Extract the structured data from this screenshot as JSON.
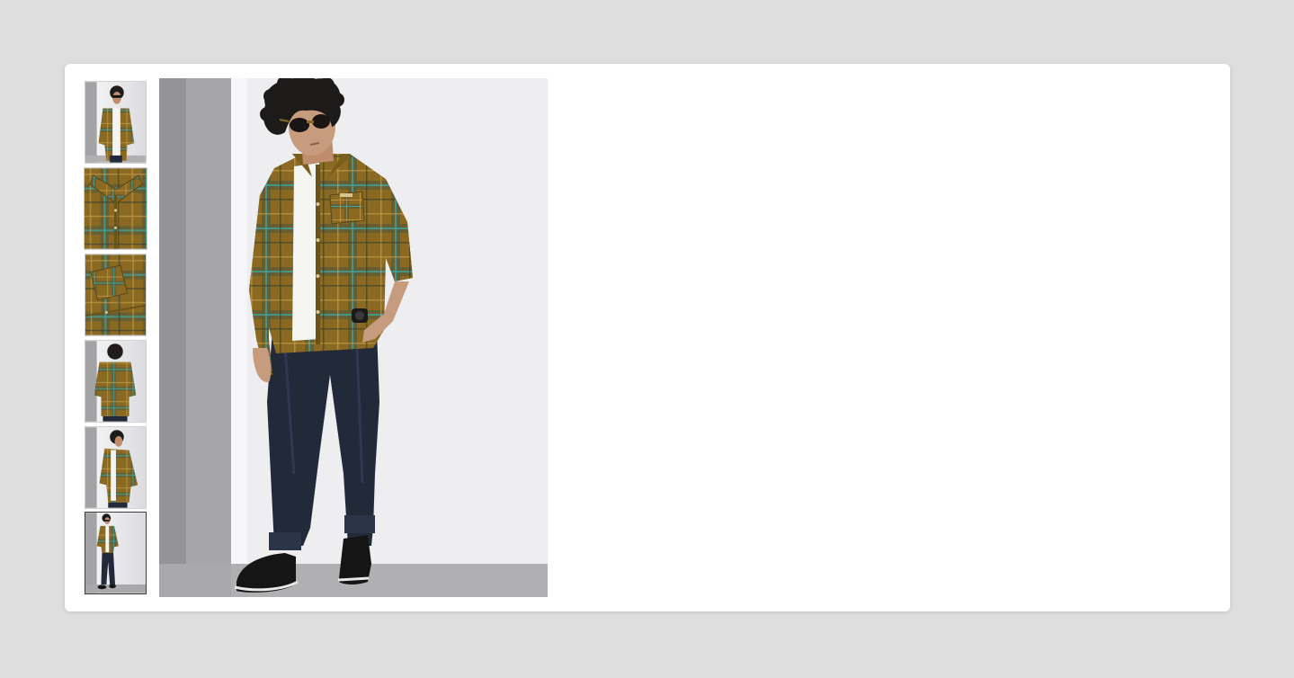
{
  "gallery": {
    "thumbnails": [
      {
        "view": "front-model-sunglasses",
        "selected": false
      },
      {
        "view": "collar-closeup",
        "selected": false
      },
      {
        "view": "fabric-pocket-closeup",
        "selected": false
      },
      {
        "view": "back-model",
        "selected": false
      },
      {
        "view": "side-model",
        "selected": false
      },
      {
        "view": "full-length-model",
        "selected": true
      }
    ],
    "main_image": {
      "view": "full-length-model"
    },
    "colors": {
      "page_background": "#dedede",
      "card_background": "#ffffff",
      "shirt_base": "#8a6a22",
      "shirt_check": "#3e5a4a",
      "jeans": "#222a3a",
      "wall_light": "#e4e4e7",
      "wall_shadow": "#9e9ea2",
      "floor": "#a9a9ab",
      "shoes": "#151515"
    }
  }
}
